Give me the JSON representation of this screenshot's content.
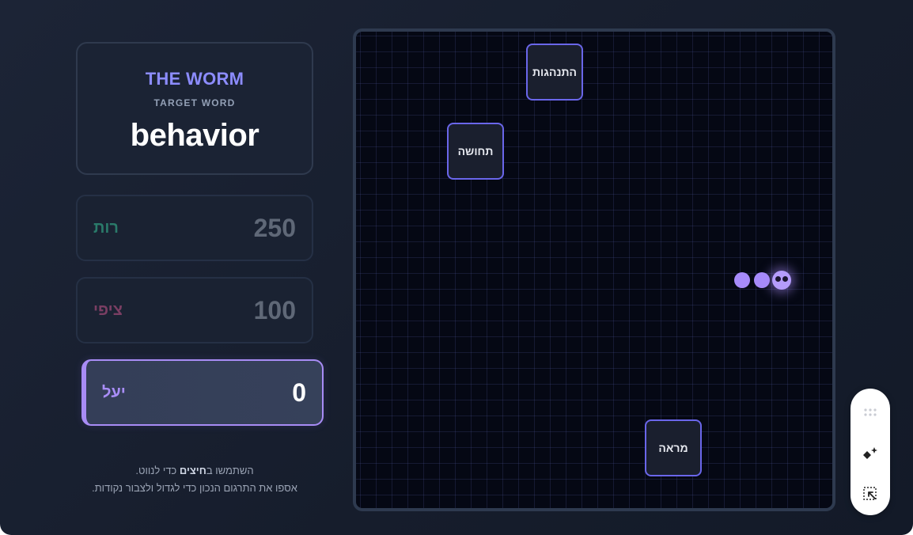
{
  "header": {
    "game_title": "THE WORM",
    "target_label": "TARGET WORD",
    "target_word": "behavior"
  },
  "players": [
    {
      "name": "רות",
      "score": "250",
      "color": "#2a7a6a"
    },
    {
      "name": "ציפי",
      "score": "100",
      "color": "#7a3e63"
    },
    {
      "name": "יעל",
      "score": "0",
      "color": "#a98df7",
      "active": true
    }
  ],
  "instructions": {
    "line1_prefix": "השתמשו ב",
    "line1_bold": "חיצים",
    "line1_suffix": " כדי לנווט.",
    "line2": "אספו את התרגום הנכון כדי לגדול ולצבור נקודות."
  },
  "board": {
    "tiles": [
      "התנהגות",
      "תחושה",
      "מראה"
    ],
    "worm": {
      "color": "#a78bfa",
      "segments": 3
    }
  },
  "toolbar": {
    "icons": [
      "drag-handle-icon",
      "sparkle-edit-icon",
      "select-element-icon"
    ]
  }
}
